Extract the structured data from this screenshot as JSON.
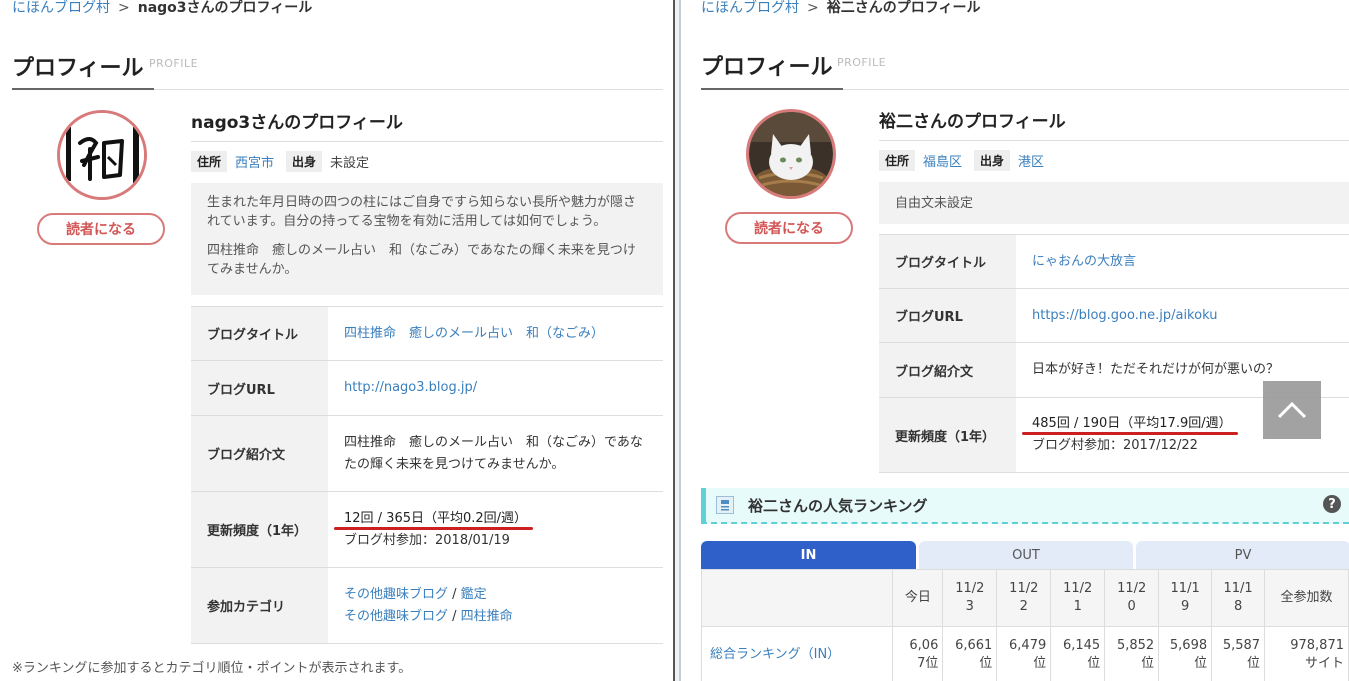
{
  "left": {
    "breadcrumb": {
      "home": "にほんブログ村",
      "sep": ">",
      "current": "nago3さんのプロフィール"
    },
    "section_title": "プロフィール",
    "section_sub": "PROFILE",
    "follow_label": "読者になる",
    "profile_name": "nago3さんのプロフィール",
    "residence_tag": "住所",
    "residence": "西宮市",
    "origin_tag": "出身",
    "origin": "未設定",
    "intro_1": "生まれた年月日時の四つの柱にはご自身ですら知らない長所や魅力が隠されています。自分の持ってる宝物を有効に活用しては如何でしょう。",
    "intro_2": "四柱推命　癒しのメール占い　和（なごみ）であなたの輝く未来を見つけてみませんか。",
    "rows": {
      "blog_title_label": "ブログタイトル",
      "blog_title": "四柱推命　癒しのメール占い　和（なごみ）",
      "blog_url_label": "ブログURL",
      "blog_url": "http://nago3.blog.jp/",
      "blog_desc_label": "ブログ紹介文",
      "blog_desc": "四柱推命　癒しのメール占い　和（なごみ）であなたの輝く未来を見つけてみませんか。",
      "freq_label": "更新頻度（1年）",
      "freq": "12回 / 365日（平均0.2回/週）",
      "joined": "ブログ村参加：2018/01/19",
      "category_label": "参加カテゴリ",
      "cat1a": "その他趣味ブログ",
      "cat1b": "鑑定",
      "cat2a": "その他趣味ブログ",
      "cat2b": "四柱推命",
      "slash": " / "
    },
    "note": "※ランキングに参加するとカテゴリ順位・ポイントが表示されます。"
  },
  "right": {
    "breadcrumb": {
      "home": "にほんブログ村",
      "sep": ">",
      "current": "裕二さんのプロフィール"
    },
    "section_title": "プロフィール",
    "section_sub": "PROFILE",
    "follow_label": "読者になる",
    "profile_name": "裕二さんのプロフィール",
    "residence_tag": "住所",
    "residence": "福島区",
    "origin_tag": "出身",
    "origin": "港区",
    "intro": "自由文未設定",
    "rows": {
      "blog_title_label": "ブログタイトル",
      "blog_title": "にゃおんの大放言",
      "blog_url_label": "ブログURL",
      "blog_url": "https://blog.goo.ne.jp/aikoku",
      "blog_desc_label": "ブログ紹介文",
      "blog_desc": "日本が好き！ただそれだけが何が悪いの？",
      "freq_label": "更新頻度（1年）",
      "freq": "485回 / 190日（平均17.9回/週）",
      "joined": "ブログ村参加：2017/12/22"
    },
    "ranking": {
      "title": "裕二さんの人気ランキング",
      "help": "?",
      "tabs": [
        "IN",
        "OUT",
        "PV"
      ],
      "headers": [
        "今日",
        "11/2\n3",
        "11/2\n2",
        "11/2\n1",
        "11/2\n0",
        "11/1\n9",
        "11/1\n8",
        "全参加数"
      ],
      "row_label": "総合ランキング（IN）",
      "row_values": [
        "6,06\n7位",
        "6,661\n位",
        "6,479\n位",
        "6,145\n位",
        "5,852\n位",
        "5,698\n位",
        "5,587\n位",
        "978,871\nサイト"
      ]
    }
  },
  "colors": {
    "link": "#3a7fbd",
    "accent_red": "#cc1f1f",
    "follow_border": "#d87a7a",
    "tab_active": "#2f5fc9"
  }
}
